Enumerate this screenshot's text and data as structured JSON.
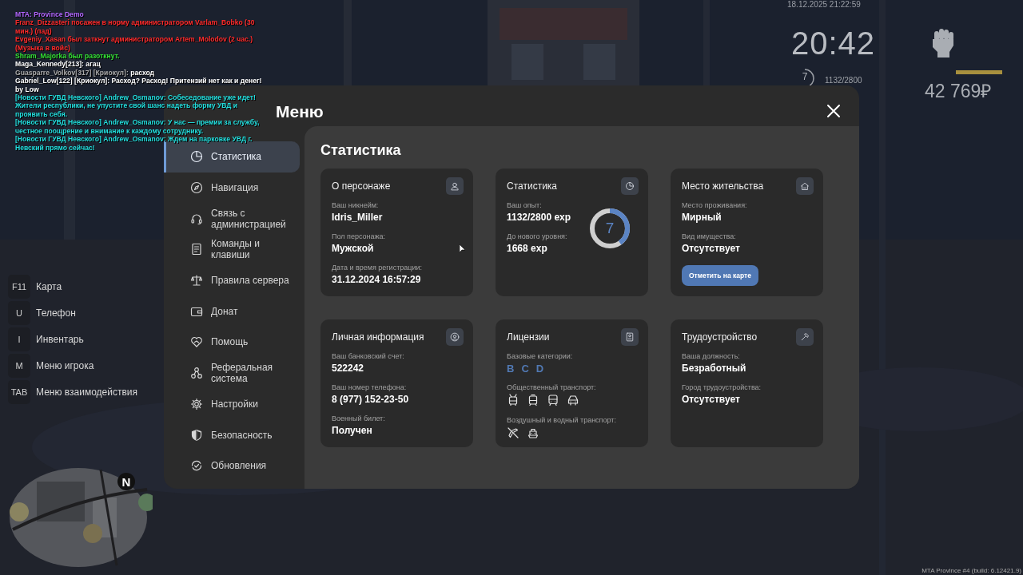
{
  "chat": [
    {
      "segments": [
        {
          "text": "MTA: Province Demo",
          "color": "#b266ff"
        }
      ]
    },
    {
      "segments": [
        {
          "text": "Franz_Dizzasteri посажен в норму администратором Varlam_Bobko (30 мин.) (пад)",
          "color": "#ff2a2a"
        }
      ]
    },
    {
      "segments": [
        {
          "text": "Evgeniy_Xasan был заткнут администратором Artem_Molodov (2 час.) (Музыка в войс)",
          "color": "#ff2a2a"
        }
      ]
    },
    {
      "segments": [
        {
          "text": "Shram_Majorka был разоткнут.",
          "color": "#33e033"
        }
      ]
    },
    {
      "segments": [
        {
          "text": "Maga_Kennedy[213]: агац",
          "color": "#ffffff"
        }
      ]
    },
    {
      "segments": [
        {
          "text": "Guasparre_Volkov[317] [Криокул]: ",
          "color": "#a8a8a8"
        },
        {
          "text": "расход",
          "color": "#ffffff"
        }
      ]
    },
    {
      "segments": [
        {
          "text": "Gabriel_Low[122] [Криокул]: Расход? Расход! Притензий нет как и денег! by Low",
          "color": "#ffffff"
        }
      ]
    },
    {
      "segments": [
        {
          "text": "[Новости ГУВД Невского] Andrew_Osmanov: Собеседование уже идет! Жители республики, не упустите свой шанс надеть форму УВД и проявить себя.",
          "color": "#22dede"
        }
      ]
    },
    {
      "segments": [
        {
          "text": "[Новости ГУВД Невского] Andrew_Osmanov: У нас — премии за службу, честное поощрение и внимание к каждому сотруднику.",
          "color": "#22dede"
        }
      ]
    },
    {
      "segments": [
        {
          "text": "[Новости ГУВД Невского] Andrew_Osmanov: Ждем на парковке УВД г. Невский прямо сейчас!",
          "color": "#22dede"
        }
      ]
    }
  ],
  "hud": {
    "datetime": "18.12.2025 21:22:59",
    "clock": "20:42",
    "level_ring": {
      "text": "7",
      "level": 0.4
    },
    "experience": "1132/2800",
    "bar": {
      "level": 1
    },
    "money": "42 769₽",
    "minimap": {
      "north": "N"
    }
  },
  "hotkeys": [
    {
      "key": "F11",
      "label": "Карта"
    },
    {
      "key": "U",
      "label": "Телефон"
    },
    {
      "key": "I",
      "label": "Инвентарь"
    },
    {
      "key": "M",
      "label": "Меню игрока"
    },
    {
      "key": "TAB",
      "label": "Меню взаимодействия"
    }
  ],
  "menu": {
    "title": "Меню",
    "sidebar": [
      {
        "label": "Статистика",
        "selected": true
      },
      {
        "label": "Навигация",
        "selected": false
      },
      {
        "label": "Связь с администрацией",
        "selected": false
      },
      {
        "label": "Команды и клавиши",
        "selected": false
      },
      {
        "label": "Правила сервера",
        "selected": false
      },
      {
        "label": "Донат",
        "selected": false
      },
      {
        "label": "Помощь",
        "selected": false
      },
      {
        "label": "Реферальная система",
        "selected": false
      },
      {
        "label": "Настройки",
        "selected": false
      },
      {
        "label": "Безопасность",
        "selected": false
      },
      {
        "label": "Обновления",
        "selected": false
      }
    ],
    "heading": "Статистика",
    "cards": [
      {
        "kind": "fields",
        "title": "О персонаже",
        "fields": [
          {
            "label": "Ваш никнейм:",
            "value": "Idris_Miller"
          },
          {
            "label": "Пол персонажа:",
            "value": "Мужской"
          },
          {
            "label": "Дата и время регистрации:",
            "value": "31.12.2024 16:57:29"
          }
        ]
      },
      {
        "kind": "progress",
        "title": "Статистика",
        "fields": [
          {
            "label": "Ваш опыт:",
            "value": "1132/2800 exp"
          },
          {
            "label": "До нового уровня:",
            "value": "1668 exp"
          }
        ],
        "ring": {
          "text": "7",
          "level": 0.4
        }
      },
      {
        "kind": "fields",
        "title": "Место жительства",
        "fields": [
          {
            "label": "Место проживания:",
            "value": "Мирный"
          },
          {
            "label": "Вид имущества:",
            "value": "Отсутствует"
          }
        ],
        "button": "Отметить на карте"
      },
      {
        "kind": "fields",
        "title": "Личная информация",
        "fields": [
          {
            "label": "Ваш банковский счет:",
            "value": "522242"
          },
          {
            "label": "Ваш номер телефона:",
            "value": "8 (977) 152-23-50"
          },
          {
            "label": "Военный билет:",
            "value": "Получен"
          }
        ]
      },
      {
        "kind": "licenses",
        "title": "Лицензии",
        "groups": [
          {
            "kind": "letters",
            "label": "Базовые категории:",
            "items": [
              "B",
              "C",
              "D"
            ]
          },
          {
            "kind": "public",
            "label": "Общественный транспорт:"
          },
          {
            "kind": "air-water",
            "label": "Воздушный и водный транспорт:"
          }
        ]
      },
      {
        "kind": "fields",
        "title": "Трудоустройство",
        "fields": [
          {
            "label": "Ваша должность:",
            "value": "Безработный"
          },
          {
            "label": "Город трудоустройства:",
            "value": "Отсутствует"
          }
        ]
      }
    ]
  },
  "build": "MTA Province #4 (build: 6.12421.9)"
}
